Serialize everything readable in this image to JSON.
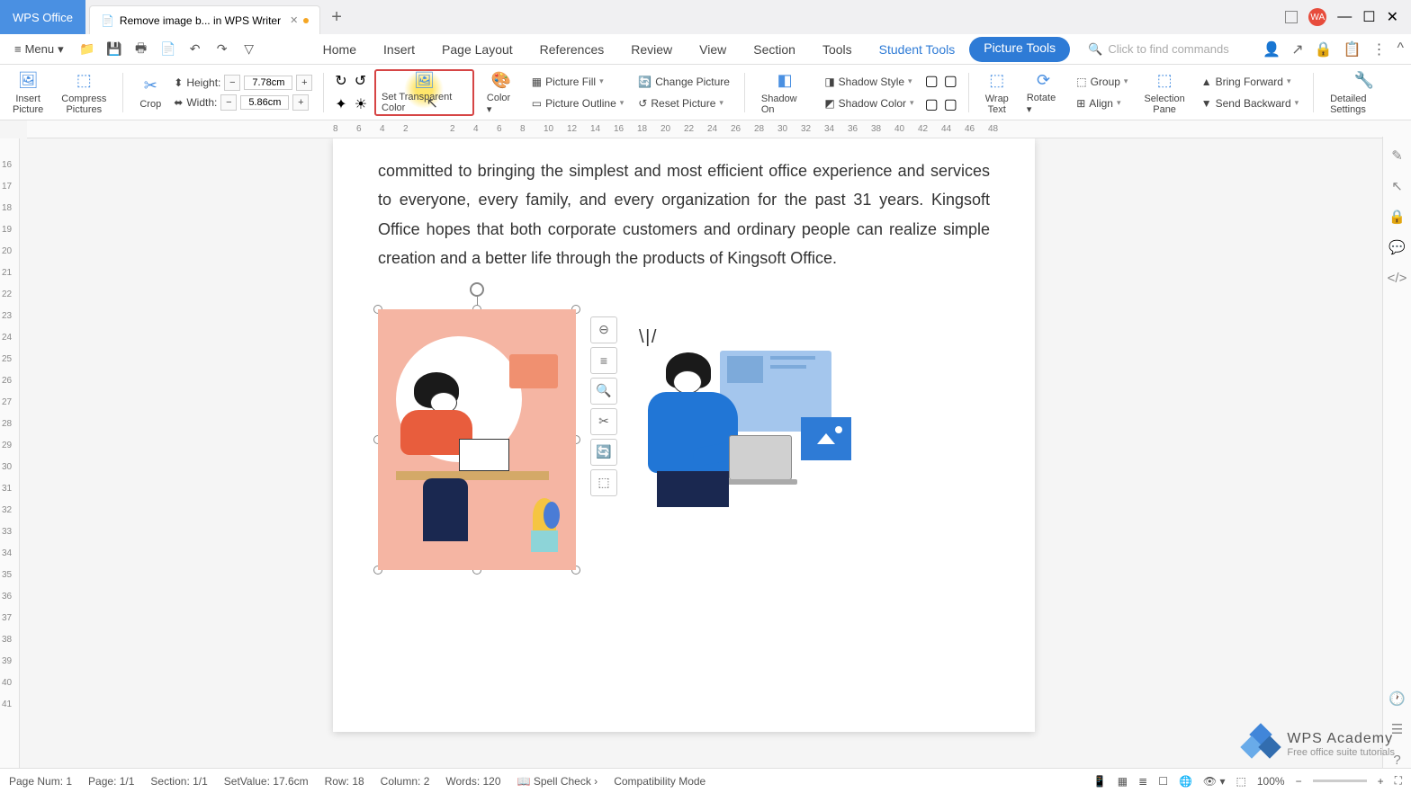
{
  "titlebar": {
    "app_tab": "WPS Office",
    "doc_tab": "Remove image b... in WPS Writer",
    "avatar": "WA"
  },
  "menubar": {
    "menu": "Menu",
    "tabs": [
      "Home",
      "Insert",
      "Page Layout",
      "References",
      "Review",
      "View",
      "Section",
      "Tools"
    ],
    "student_tools": "Student Tools",
    "picture_tools": "Picture Tools",
    "search_ph": "Click to find commands"
  },
  "ribbon": {
    "insert_picture": "Insert\nPicture",
    "compress": "Compress\nPictures",
    "crop": "Crop",
    "height_label": "Height:",
    "height_val": "7.78cm",
    "width_label": "Width:",
    "width_val": "5.86cm",
    "set_transparent": "Set Transparent Color",
    "color": "Color",
    "picture_fill": "Picture Fill",
    "picture_outline": "Picture Outline",
    "change_picture": "Change Picture",
    "reset_picture": "Reset Picture",
    "shadow_on": "Shadow On",
    "shadow_style": "Shadow Style",
    "shadow_color": "Shadow Color",
    "wrap_text": "Wrap\nText",
    "rotate": "Rotate",
    "group": "Group",
    "align": "Align",
    "selection_pane": "Selection\nPane",
    "bring_forward": "Bring Forward",
    "send_backward": "Send Backward",
    "detailed": "Detailed Settings"
  },
  "ruler_h": [
    "8",
    "6",
    "4",
    "2",
    "",
    "2",
    "4",
    "6",
    "8",
    "10",
    "12",
    "14",
    "16",
    "18",
    "20",
    "22",
    "24",
    "26",
    "28",
    "30",
    "32",
    "34",
    "36",
    "38",
    "40",
    "42",
    "44",
    "46",
    "48"
  ],
  "ruler_v": [
    "",
    "16",
    "17",
    "18",
    "19",
    "20",
    "21",
    "22",
    "23",
    "24",
    "25",
    "26",
    "27",
    "28",
    "29",
    "30",
    "31",
    "32",
    "33",
    "34",
    "35",
    "36",
    "37",
    "38",
    "39",
    "40",
    "41"
  ],
  "doc_text": "committed to bringing the simplest and most efficient office experience and services to everyone, every family, and every organization for the past 31 years. Kingsoft Office hopes that both corporate customers and ordinary people can realize simple creation and a better life through the products of Kingsoft Office.",
  "status": {
    "page_num": "Page Num: 1",
    "page": "Page: 1/1",
    "section": "Section: 1/1",
    "setvalue": "SetValue: 17.6cm",
    "row": "Row: 18",
    "column": "Column: 2",
    "words": "Words: 120",
    "spell": "Spell Check",
    "compat": "Compatibility Mode",
    "zoom": "100%"
  },
  "watermark": {
    "main": "WPS Academy",
    "sub": "Free office suite tutorials"
  }
}
